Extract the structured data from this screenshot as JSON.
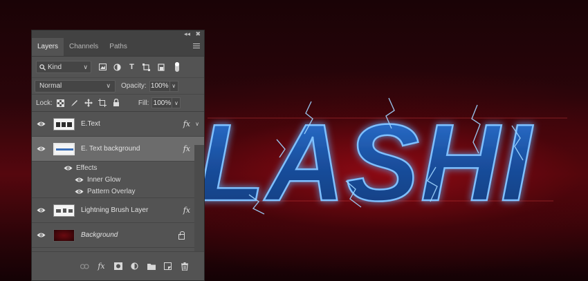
{
  "artwork": {
    "visible_text": "LASHI"
  },
  "panel": {
    "tabs": [
      {
        "label": "Layers",
        "active": true
      },
      {
        "label": "Channels",
        "active": false
      },
      {
        "label": "Paths",
        "active": false
      }
    ],
    "filter": {
      "kind_label": "Kind",
      "icons": [
        "image-filter-icon",
        "adjustment-filter-icon",
        "type-filter-icon",
        "shape-filter-icon",
        "smart-object-filter-icon",
        "filter-toggle-icon"
      ]
    },
    "blend_mode": "Normal",
    "opacity_label": "Opacity:",
    "opacity_value": "100%",
    "lock_label": "Lock:",
    "lock_icons": [
      "lock-transparent-pixels-icon",
      "lock-image-pixels-icon",
      "lock-position-icon",
      "lock-artboard-icon",
      "lock-all-icon"
    ],
    "fill_label": "Fill:",
    "fill_value": "100%",
    "layers": [
      {
        "name": "E.Text",
        "fx": "fx",
        "selected": false
      },
      {
        "name": "E. Text background",
        "fx": "fx",
        "selected": true,
        "effects_label": "Effects",
        "effects": [
          "Inner Glow",
          "Pattern Overlay"
        ]
      },
      {
        "name": "Lightning Brush Layer",
        "fx": "fx",
        "selected": false
      },
      {
        "name": "Background",
        "locked": true,
        "selected": false
      }
    ],
    "footer_icons": [
      "link-layers-icon",
      "add-layer-style-icon",
      "add-mask-icon",
      "new-adjustment-layer-icon",
      "new-group-icon",
      "new-layer-icon",
      "delete-layer-icon"
    ]
  },
  "colors": {
    "panel_bg": "#535353",
    "selected_row": "#6c6c6c",
    "canvas_red": "#55070e",
    "text_blue": "#1f5fb8"
  }
}
